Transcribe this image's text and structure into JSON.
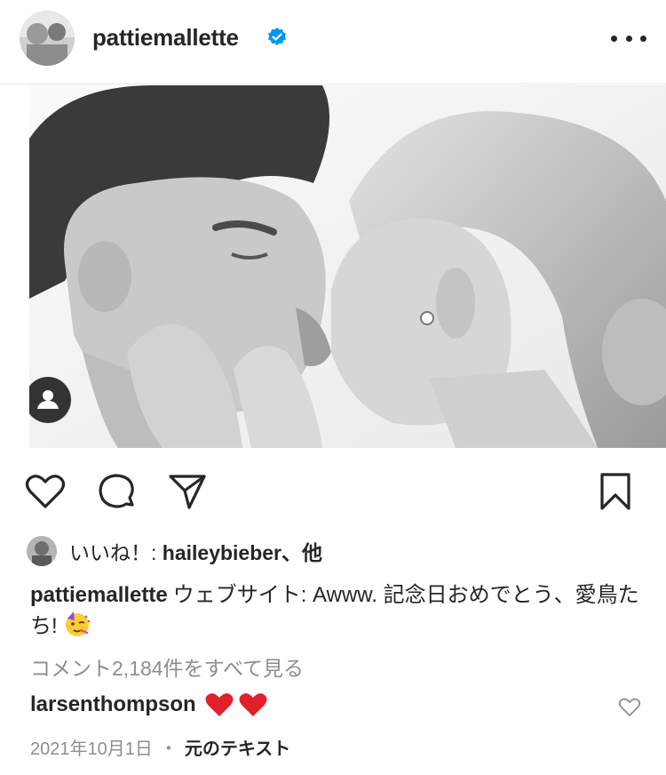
{
  "post": {
    "username": "pattiemallette",
    "verified": true,
    "more_icon": "more-horizontal-icon"
  },
  "photo": {
    "tag_icon": "user-tag-icon"
  },
  "actions": {
    "like_icon": "heart-outline-icon",
    "comment_icon": "comment-bubble-icon",
    "share_icon": "paper-plane-icon",
    "save_icon": "bookmark-icon"
  },
  "likes": {
    "prefix": "いいね！: ",
    "user": "haileybieber",
    "suffix": "、他"
  },
  "caption": {
    "user": "pattiemallette",
    "text": "ウェブサイト: Awww. 記念日おめでとう、愛鳥たち!",
    "emoji": "partying-face-emoji"
  },
  "comments": {
    "view_all": "コメント2,184件をすべて見る",
    "items": [
      {
        "user": "larsenthompson",
        "emoji": "red-heart-emoji x2"
      }
    ]
  },
  "footer": {
    "date": "2021年10月1日",
    "separator": "・",
    "see_original": "元のテキスト"
  },
  "colors": {
    "text": "#262626",
    "secondary": "#8e8e8e",
    "verified": "#0095f6",
    "heart": "#ed1c24"
  }
}
